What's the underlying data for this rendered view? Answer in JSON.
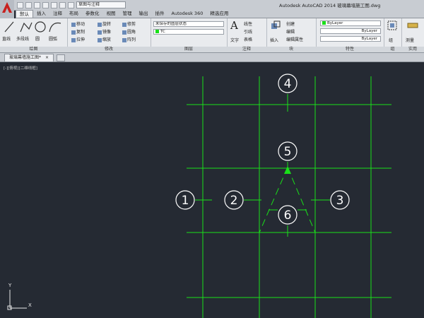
{
  "app": {
    "title": "Autodesk AutoCAD 2014   玻璃幕墙施工图.dwg",
    "workspace": "草图与注释"
  },
  "ribbon_tabs": [
    "默认",
    "插入",
    "注释",
    "布局",
    "参数化",
    "视图",
    "管理",
    "输出",
    "插件",
    "Autodesk 360",
    "精选应用"
  ],
  "panels": {
    "draw": {
      "title": "绘图",
      "line": "直线",
      "polyline": "多段线",
      "circle": "圆",
      "arc": "圆弧"
    },
    "modify": {
      "title": "修改",
      "move": "移动",
      "rotate": "旋转",
      "trim": "修剪",
      "copy": "复制",
      "mirror": "镜像",
      "fillet": "圆角",
      "stretch": "拉伸",
      "scale": "缩放",
      "array": "阵列"
    },
    "layers": {
      "title": "图层",
      "state": "未保存的图层状态",
      "current": "TC"
    },
    "annotation": {
      "title": "注释",
      "text": "文字",
      "linear": "线性",
      "leader": "引线",
      "table": "表格"
    },
    "block": {
      "title": "块",
      "insert": "插入",
      "create": "创建",
      "edit": "编辑",
      "edit_attr": "编辑属性"
    },
    "properties": {
      "title": "特性",
      "color": "ByLayer",
      "linetype": "ByLayer",
      "lineweight": "ByLayer"
    },
    "groups": {
      "title": "组",
      "group": "组"
    },
    "utilities": {
      "title": "实用",
      "measure": "测量"
    }
  },
  "document_tab": "玻璃幕墙施工图*",
  "viewport_label": "[-][俯视][二维线框]",
  "ucs": {
    "x": "X",
    "y": "Y"
  },
  "markers": [
    "1",
    "2",
    "3",
    "4",
    "5",
    "6"
  ],
  "colors": {
    "canvas": "#252a33",
    "geometry": "#19e019",
    "marker": "#ffffff"
  }
}
